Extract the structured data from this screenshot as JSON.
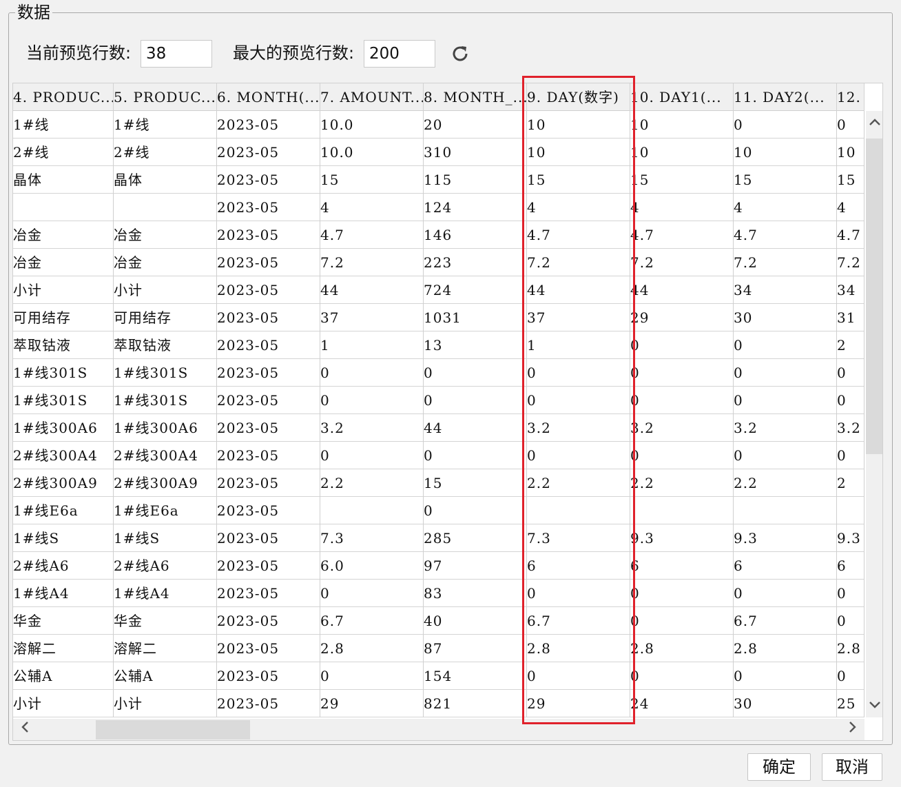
{
  "group_title": "数据",
  "preview": {
    "current_label": "当前预览行数:",
    "current_value": "38",
    "max_label": "最大的预览行数:",
    "max_value": "200"
  },
  "table": {
    "columns": [
      "4. PRODUC...",
      "5. PRODUC...",
      "6. MONTH(...",
      "7. AMOUNT...",
      "8. MONTH_...",
      "9. DAY(数字)",
      "10. DAY1(...",
      "11. DAY2(...",
      "12."
    ],
    "rows": [
      [
        "1#线",
        "1#线",
        "2023-05",
        "10.0",
        "20",
        "10",
        "10",
        "0",
        "0"
      ],
      [
        "2#线",
        "2#线",
        "2023-05",
        "10.0",
        "310",
        "10",
        "10",
        "10",
        "10"
      ],
      [
        "晶体",
        "晶体",
        "2023-05",
        "15",
        "115",
        "15",
        "15",
        "15",
        "15"
      ],
      [
        "",
        "",
        "2023-05",
        "4",
        "124",
        "4",
        "4",
        "4",
        "4"
      ],
      [
        "冶金",
        "冶金",
        "2023-05",
        "4.7",
        "146",
        "4.7",
        "4.7",
        "4.7",
        "4.7"
      ],
      [
        "冶金",
        "冶金",
        "2023-05",
        "7.2",
        "223",
        "7.2",
        "7.2",
        "7.2",
        "7.2"
      ],
      [
        "小计",
        "小计",
        "2023-05",
        "44",
        "724",
        "44",
        "44",
        "34",
        "34"
      ],
      [
        "可用结存",
        "可用结存",
        "2023-05",
        "37",
        "1031",
        "37",
        "29",
        "30",
        "31"
      ],
      [
        "萃取钴液",
        "萃取钴液",
        "2023-05",
        "1",
        "13",
        "1",
        "0",
        "0",
        "2"
      ],
      [
        "1#线301S",
        "1#线301S",
        "2023-05",
        "0",
        "0",
        "0",
        "0",
        "0",
        "0"
      ],
      [
        "1#线301S",
        "1#线301S",
        "2023-05",
        "0",
        "0",
        "0",
        "0",
        "0",
        "0"
      ],
      [
        "1#线300A6",
        "1#线300A6",
        "2023-05",
        "3.2",
        "44",
        "3.2",
        "3.2",
        "3.2",
        "3.2"
      ],
      [
        "2#线300A4",
        "2#线300A4",
        "2023-05",
        "0",
        "0",
        "0",
        "0",
        "0",
        "0"
      ],
      [
        "2#线300A9",
        "2#线300A9",
        "2023-05",
        "2.2",
        "15",
        "2.2",
        "2.2",
        "2.2",
        "2"
      ],
      [
        "1#线E6a",
        "1#线E6a",
        "2023-05",
        "",
        "0",
        "",
        "",
        "",
        ""
      ],
      [
        "1#线S",
        "1#线S",
        "2023-05",
        "7.3",
        "285",
        "7.3",
        "9.3",
        "9.3",
        "9.3"
      ],
      [
        "2#线A6",
        "2#线A6",
        "2023-05",
        "6.0",
        "97",
        "6",
        "6",
        "6",
        "6"
      ],
      [
        "1#线A4",
        "1#线A4",
        "2023-05",
        "0",
        "83",
        "0",
        "0",
        "0",
        "0"
      ],
      [
        "华金",
        "华金",
        "2023-05",
        "6.7",
        "40",
        "6.7",
        "0",
        "6.7",
        "0"
      ],
      [
        "溶解二",
        "溶解二",
        "2023-05",
        "2.8",
        "87",
        "2.8",
        "2.8",
        "2.8",
        "2.8"
      ],
      [
        "公辅A",
        "公辅A",
        "2023-05",
        "0",
        "154",
        "0",
        "0",
        "0",
        "0"
      ],
      [
        "小计",
        "小计",
        "2023-05",
        "29",
        "821",
        "29",
        "24",
        "30",
        "25"
      ]
    ]
  },
  "buttons": {
    "ok": "确定",
    "cancel": "取消"
  },
  "colors": {
    "highlight": "#e0212b"
  },
  "icons": {
    "refresh": "refresh-icon",
    "up": "chevron-up-icon",
    "down": "chevron-down-icon",
    "left": "chevron-left-icon",
    "right": "chevron-right-icon"
  }
}
